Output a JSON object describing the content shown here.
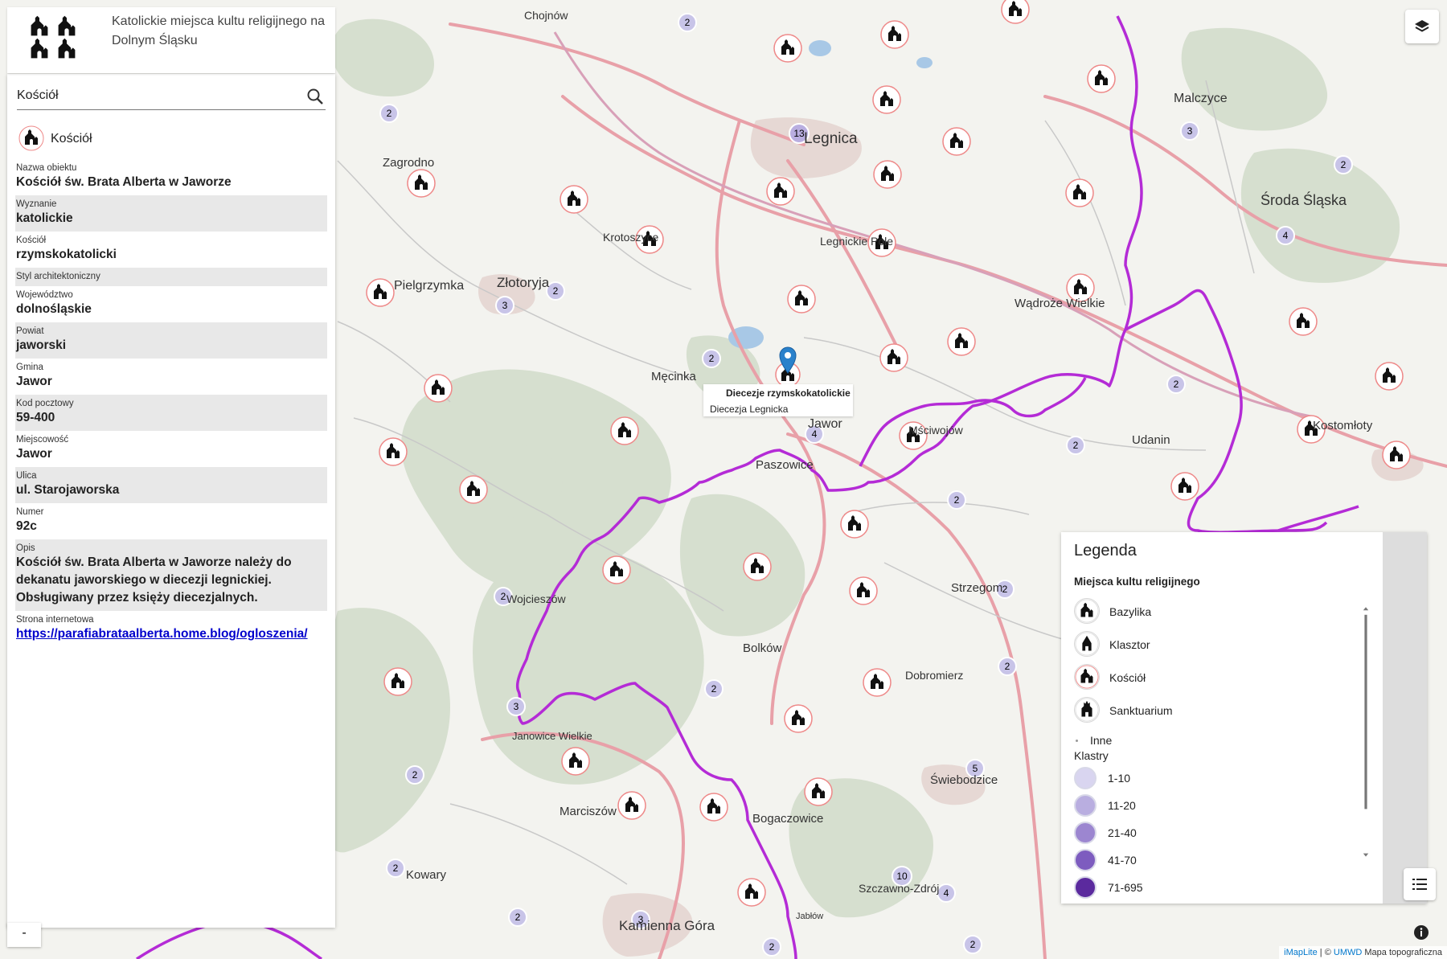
{
  "header": {
    "title": "Katolickie miejsca kultu religijnego na Dolnym Śląsku"
  },
  "search": {
    "value": "Kościół"
  },
  "feature": {
    "type_label": "Kościół",
    "fields": [
      {
        "label": "Nazwa obiektu",
        "value": "Kościół św. Brata Alberta w Jaworze"
      },
      {
        "label": "Wyznanie",
        "value": "katolickie"
      },
      {
        "label": "Kościół",
        "value": "rzymskokatolicki"
      },
      {
        "label": "Styl architektoniczny",
        "value": ""
      },
      {
        "label": "Województwo",
        "value": "dolnośląskie"
      },
      {
        "label": "Powiat",
        "value": "jaworski"
      },
      {
        "label": "Gmina",
        "value": "Jawor"
      },
      {
        "label": "Kod pocztowy",
        "value": "59-400"
      },
      {
        "label": "Miejscowość",
        "value": "Jawor"
      },
      {
        "label": "Ulica",
        "value": "ul. Starojaworska"
      },
      {
        "label": "Numer",
        "value": "92c"
      },
      {
        "label": "Opis",
        "value": "Kościół św. Brata Alberta w Jaworze należy do dekanatu jaworskiego w diecezji legnickiej. Obsługiwany przez księży diecezjalnych."
      }
    ],
    "website_label": "Strona internetowa",
    "website": "https://parafiabrataalberta.home.blog/ogloszenia/"
  },
  "popup": {
    "line1": "Diecezje rzymskokatolickie",
    "line2": "Diecezja Legnicka"
  },
  "legend": {
    "title": "Legenda",
    "section": "Miejsca kultu religijnego",
    "items": [
      {
        "label": "Bazylika",
        "icon": "basilica-icon"
      },
      {
        "label": "Klasztor",
        "icon": "monastery-icon"
      },
      {
        "label": "Kościół",
        "icon": "church-icon"
      },
      {
        "label": "Sanktuarium",
        "icon": "sanctuary-icon"
      }
    ],
    "other": "Inne",
    "clusters_title": "Klastry",
    "clusters": [
      {
        "label": "1-10",
        "color": "#d9d5f0"
      },
      {
        "label": "11-20",
        "color": "#b9aee0"
      },
      {
        "label": "21-40",
        "color": "#9c86d0"
      },
      {
        "label": "41-70",
        "color": "#7d5cbf"
      },
      {
        "label": "71-695",
        "color": "#5b2a9e"
      }
    ]
  },
  "map": {
    "boundary_color": "#b42bd6",
    "marker_color": "#2a81cb",
    "places": [
      {
        "name": "Chojnów"
      },
      {
        "name": "Legnica"
      },
      {
        "name": "Złotoryja"
      },
      {
        "name": "Jawor"
      },
      {
        "name": "Paszowice"
      },
      {
        "name": "Bolków"
      },
      {
        "name": "Męcinka"
      },
      {
        "name": "Środa Śląska"
      },
      {
        "name": "Malczyce"
      },
      {
        "name": "Strzegom"
      },
      {
        "name": "Świebodzice"
      },
      {
        "name": "Bogaczowice"
      },
      {
        "name": "Marciszów"
      },
      {
        "name": "Kamienna Góra"
      },
      {
        "name": "Kowary"
      },
      {
        "name": "Pielgrzymka"
      },
      {
        "name": "Wądroże Wielkie"
      },
      {
        "name": "Udanin"
      },
      {
        "name": "Kostomłoty"
      },
      {
        "name": "Zagrodno"
      },
      {
        "name": "Jabłów"
      },
      {
        "name": "Szczawno-Zdrój"
      },
      {
        "name": "Wojcieszów"
      },
      {
        "name": "Dobromierz"
      },
      {
        "name": "Janowice Wielkie"
      },
      {
        "name": "Legnickie Pole"
      },
      {
        "name": "Mściwojów"
      },
      {
        "name": "Krotoszyce"
      }
    ]
  },
  "attribution": {
    "lib": "iMapLite",
    "text": "| ©",
    "source": "UMWD",
    "layer": "Mapa topograficzna"
  },
  "controls": {
    "zoom_minus": "-"
  }
}
